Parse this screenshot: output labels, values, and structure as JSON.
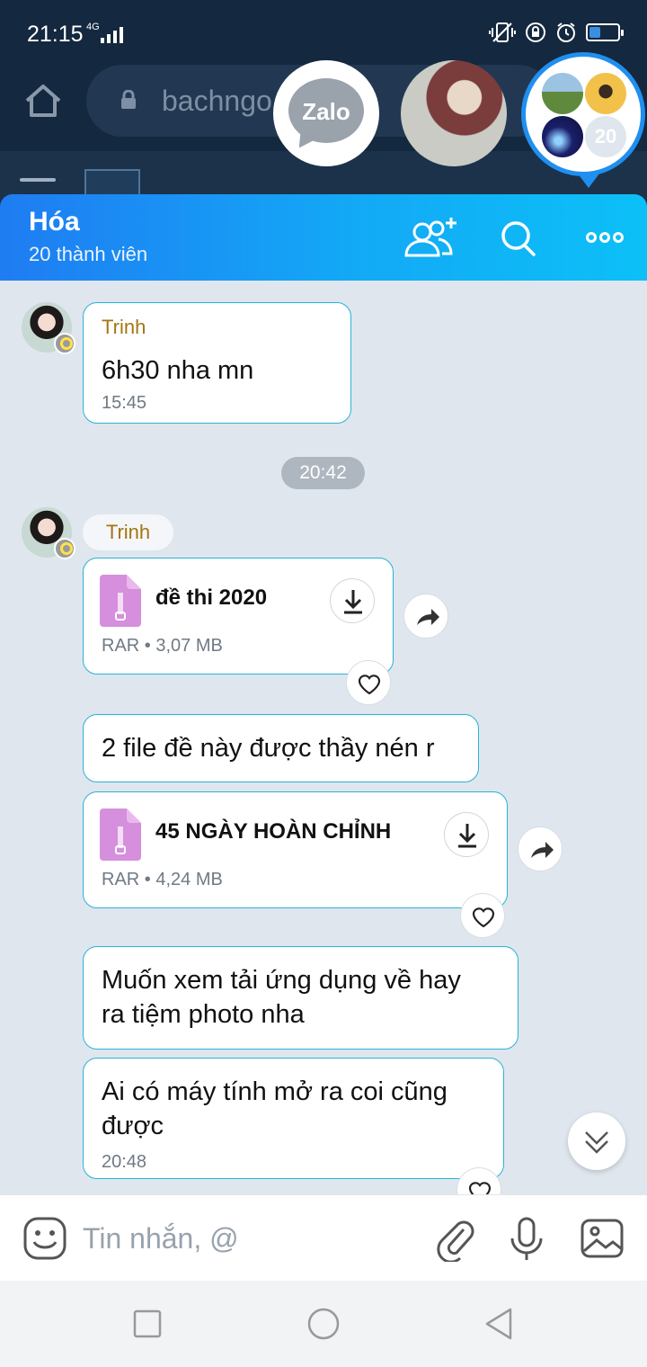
{
  "status": {
    "time": "21:15",
    "network": "4G"
  },
  "browser": {
    "url_text": "bachngo"
  },
  "chat_heads": {
    "zalo_label": "Zalo",
    "group_count": "20"
  },
  "header": {
    "title": "Hóa",
    "subtitle": "20 thành viên"
  },
  "messages": {
    "m1": {
      "sender": "Trinh",
      "text": "6h30 nha mn",
      "time": "15:45"
    },
    "divider_time": "20:42",
    "sender2": "Trinh",
    "file1": {
      "name": "đề thi 2020",
      "meta": "RAR • 3,07 MB"
    },
    "m2": {
      "text": "2 file đề này được thầy nén r"
    },
    "file2": {
      "name": "45 NGÀY HOÀN CHỈNH",
      "meta": "RAR • 4,24 MB"
    },
    "m3": {
      "line1": "Muốn xem tải ứng dụng về hay",
      "line2": "ra tiệm photo nha"
    },
    "m4": {
      "line1": "Ai có máy tính mở ra coi cũng",
      "line2": "được",
      "time": "20:48"
    }
  },
  "input": {
    "placeholder": "Tin nhắn, @"
  },
  "colors": {
    "header_start": "#1f7cf2",
    "header_end": "#0cc0f7",
    "bubble_border": "#28b3d6",
    "sender": "#a57512",
    "file_icon": "#d68fdc"
  }
}
